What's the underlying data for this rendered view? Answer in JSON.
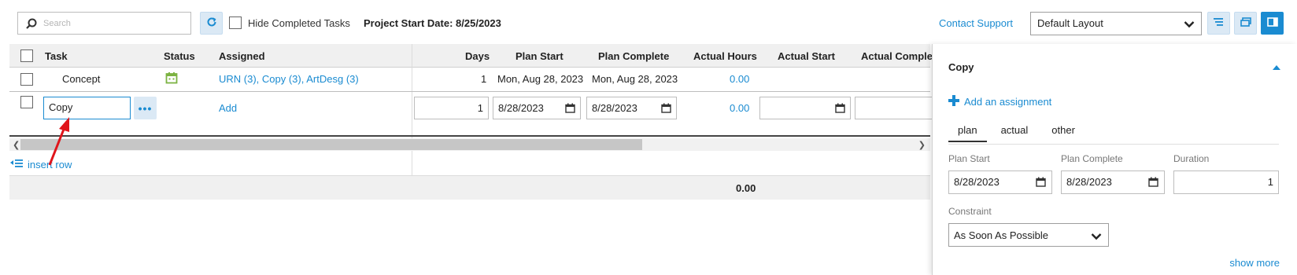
{
  "toolbar": {
    "search_placeholder": "Search",
    "hide_completed_label": "Hide Completed Tasks",
    "project_start": "Project Start Date: 8/25/2023",
    "contact_support": "Contact Support",
    "layout_value": "Default Layout"
  },
  "grid": {
    "columns": {
      "task": "Task",
      "status": "Status",
      "assigned": "Assigned",
      "days": "Days",
      "plan_start": "Plan Start",
      "plan_complete": "Plan Complete",
      "actual_hours": "Actual Hours",
      "actual_start": "Actual Start",
      "actual_complete": "Actual Complete"
    },
    "rows": [
      {
        "task": "Concept",
        "status_icon": "calendar-icon",
        "assigned": "URN (3), Copy (3), ArtDesg (3)",
        "days": "1",
        "plan_start": "Mon, Aug 28, 2023",
        "plan_complete": "Mon, Aug 28, 2023",
        "actual_hours": "0.00"
      }
    ],
    "edit_row": {
      "task_value": "Copy",
      "more_label": "•••",
      "assigned_add": "Add",
      "days_value": "1",
      "plan_start_value": "8/28/2023",
      "plan_complete_value": "8/28/2023",
      "actual_hours": "0.00"
    },
    "insert_row_label": "insert row",
    "total_hours": "0.00"
  },
  "panel": {
    "title": "Copy",
    "add_assignment": "Add an assignment",
    "tabs": [
      {
        "label": "plan",
        "active": true
      },
      {
        "label": "actual",
        "active": false
      },
      {
        "label": "other",
        "active": false
      }
    ],
    "plan_start_label": "Plan Start",
    "plan_start_value": "8/28/2023",
    "plan_complete_label": "Plan Complete",
    "plan_complete_value": "8/28/2023",
    "duration_label": "Duration",
    "duration_value": "1",
    "constraint_label": "Constraint",
    "constraint_value": "As Soon As Possible",
    "show_more": "show more"
  },
  "colors": {
    "accent": "#1a8bd1",
    "status_green": "#7cb342",
    "annotation_red": "#e0151b"
  }
}
